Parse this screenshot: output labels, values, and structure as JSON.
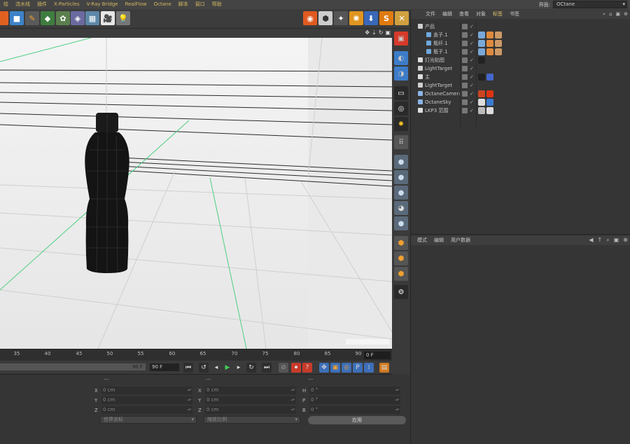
{
  "menu": [
    "绘",
    "流水线",
    "插件",
    "X-Particles",
    "V-Ray Bridge",
    "RealFlow",
    "Octane",
    "脚本",
    "窗口",
    "帮助"
  ],
  "layout": {
    "label": "界面:",
    "value": "OCtane"
  },
  "object_manager": {
    "tabs": [
      "文件",
      "编辑",
      "查看",
      "对象",
      "标签",
      "书签"
    ],
    "active_tab": "标签",
    "rows": [
      {
        "name": "产品",
        "indent": 0,
        "icon_color": "#cfcfcf",
        "tags": []
      },
      {
        "name": "盖子.1",
        "indent": 2,
        "icon_color": "#6fa8dc",
        "tags": [
          "#7aa8d8",
          "#e08a3c",
          "#cc9966"
        ]
      },
      {
        "name": "瓶纤.1",
        "indent": 2,
        "icon_color": "#6fa8dc",
        "tags": [
          "#7aa8d8",
          "#e08a3c",
          "#cc9966"
        ]
      },
      {
        "name": "瓶子.1",
        "indent": 2,
        "icon_color": "#6fa8dc",
        "tags": [
          "#7aa8d8",
          "#e08a3c",
          "#cc9966"
        ]
      },
      {
        "name": "灯光贴图",
        "indent": 0,
        "icon_color": "#dddddd",
        "tags": [
          "#222222"
        ]
      },
      {
        "name": "LightTarget",
        "indent": 0,
        "icon_color": "#cfcfcf",
        "tags": []
      },
      {
        "name": "主",
        "indent": 0,
        "icon_color": "#dddddd",
        "tags": [
          "#222222",
          "#4466cc"
        ]
      },
      {
        "name": "LightTarget",
        "indent": 0,
        "icon_color": "#cfcfcf",
        "tags": []
      },
      {
        "name": "OctaneCamera",
        "indent": 0,
        "icon_color": "#8ab4e8",
        "tags": [
          "#cc4422",
          "#dd3311"
        ]
      },
      {
        "name": "OctaneSky",
        "indent": 0,
        "icon_color": "#8ab4e8",
        "tags": [
          "#dddddd",
          "#3b7bd0"
        ]
      },
      {
        "name": "LKP3 范围",
        "indent": 0,
        "icon_color": "#dddddd",
        "tags": [
          "#bbbbbb",
          "#dddddd"
        ]
      }
    ]
  },
  "attribute_manager": {
    "tabs": [
      "模式",
      "编辑",
      "用户数据"
    ]
  },
  "timeline": {
    "ticks": [
      "35",
      "40",
      "45",
      "50",
      "55",
      "60",
      "65",
      "70",
      "75",
      "80",
      "85",
      "90"
    ],
    "current_frame": "0 F",
    "slider_label": "90 F",
    "end_frame": "90 F"
  },
  "coordinates": {
    "headers": [
      "---",
      "---",
      "---"
    ],
    "position": [
      {
        "axis": "X",
        "value": "0 cm"
      },
      {
        "axis": "Y",
        "value": "0 cm"
      },
      {
        "axis": "Z",
        "value": "0 cm"
      }
    ],
    "size": [
      {
        "axis": "X",
        "value": "0 cm"
      },
      {
        "axis": "Y",
        "value": "0 cm"
      },
      {
        "axis": "Z",
        "value": "0 cm"
      }
    ],
    "rotation": [
      {
        "axis": "H",
        "value": "0 °"
      },
      {
        "axis": "P",
        "value": "0 °"
      },
      {
        "axis": "B",
        "value": "0 °"
      }
    ],
    "mode_dropdown": "世界坐标",
    "scale_dropdown": "缩放比例",
    "apply_label": "应用"
  }
}
